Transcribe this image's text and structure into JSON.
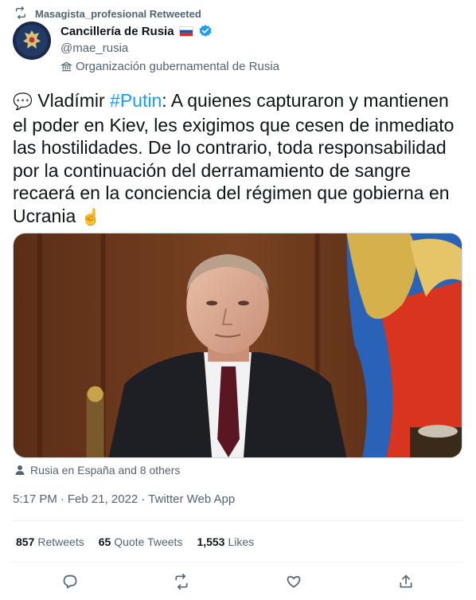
{
  "retweet": {
    "text": "Masagista_profesional Retweeted",
    "icon": "retweet-icon"
  },
  "author": {
    "name": "Cancillería de Rusia",
    "handle": "@mae_rusia",
    "label": "Organización gubernamental de Rusia",
    "flag_icon": "russia-flag-icon",
    "verified_icon": "verified-badge-icon",
    "badge_color": "#1d9bf0"
  },
  "tweet": {
    "emoji": "💬",
    "pre_hashtag": " Vladímir ",
    "hashtag": "#Putin",
    "post_hashtag": ": A quienes capturaron y mantienen el poder en Kiev, les exigimos que cesen de inmediato las hostilidades. De lo contrario, toda responsabilidad por la continuación del derramamiento de sangre recaerá en la conciencia del régimen que gobierna en Ucrania ",
    "end_emoji": "☝️",
    "hashtag_color": "#1d9bf0"
  },
  "tagged": {
    "text": "Rusia en España and 8 others",
    "icon": "person-icon"
  },
  "meta": {
    "time": "5:17 PM",
    "sep1": " · ",
    "date": "Feb 21, 2022",
    "sep2": " · ",
    "source": "Twitter Web App"
  },
  "stats": {
    "retweets_count": "857",
    "retweets_label": "Retweets",
    "quotes_count": "65",
    "quotes_label": "Quote Tweets",
    "likes_count": "1,553",
    "likes_label": "Likes"
  },
  "actions": [
    "reply-icon",
    "retweet-icon",
    "like-icon",
    "share-icon"
  ]
}
